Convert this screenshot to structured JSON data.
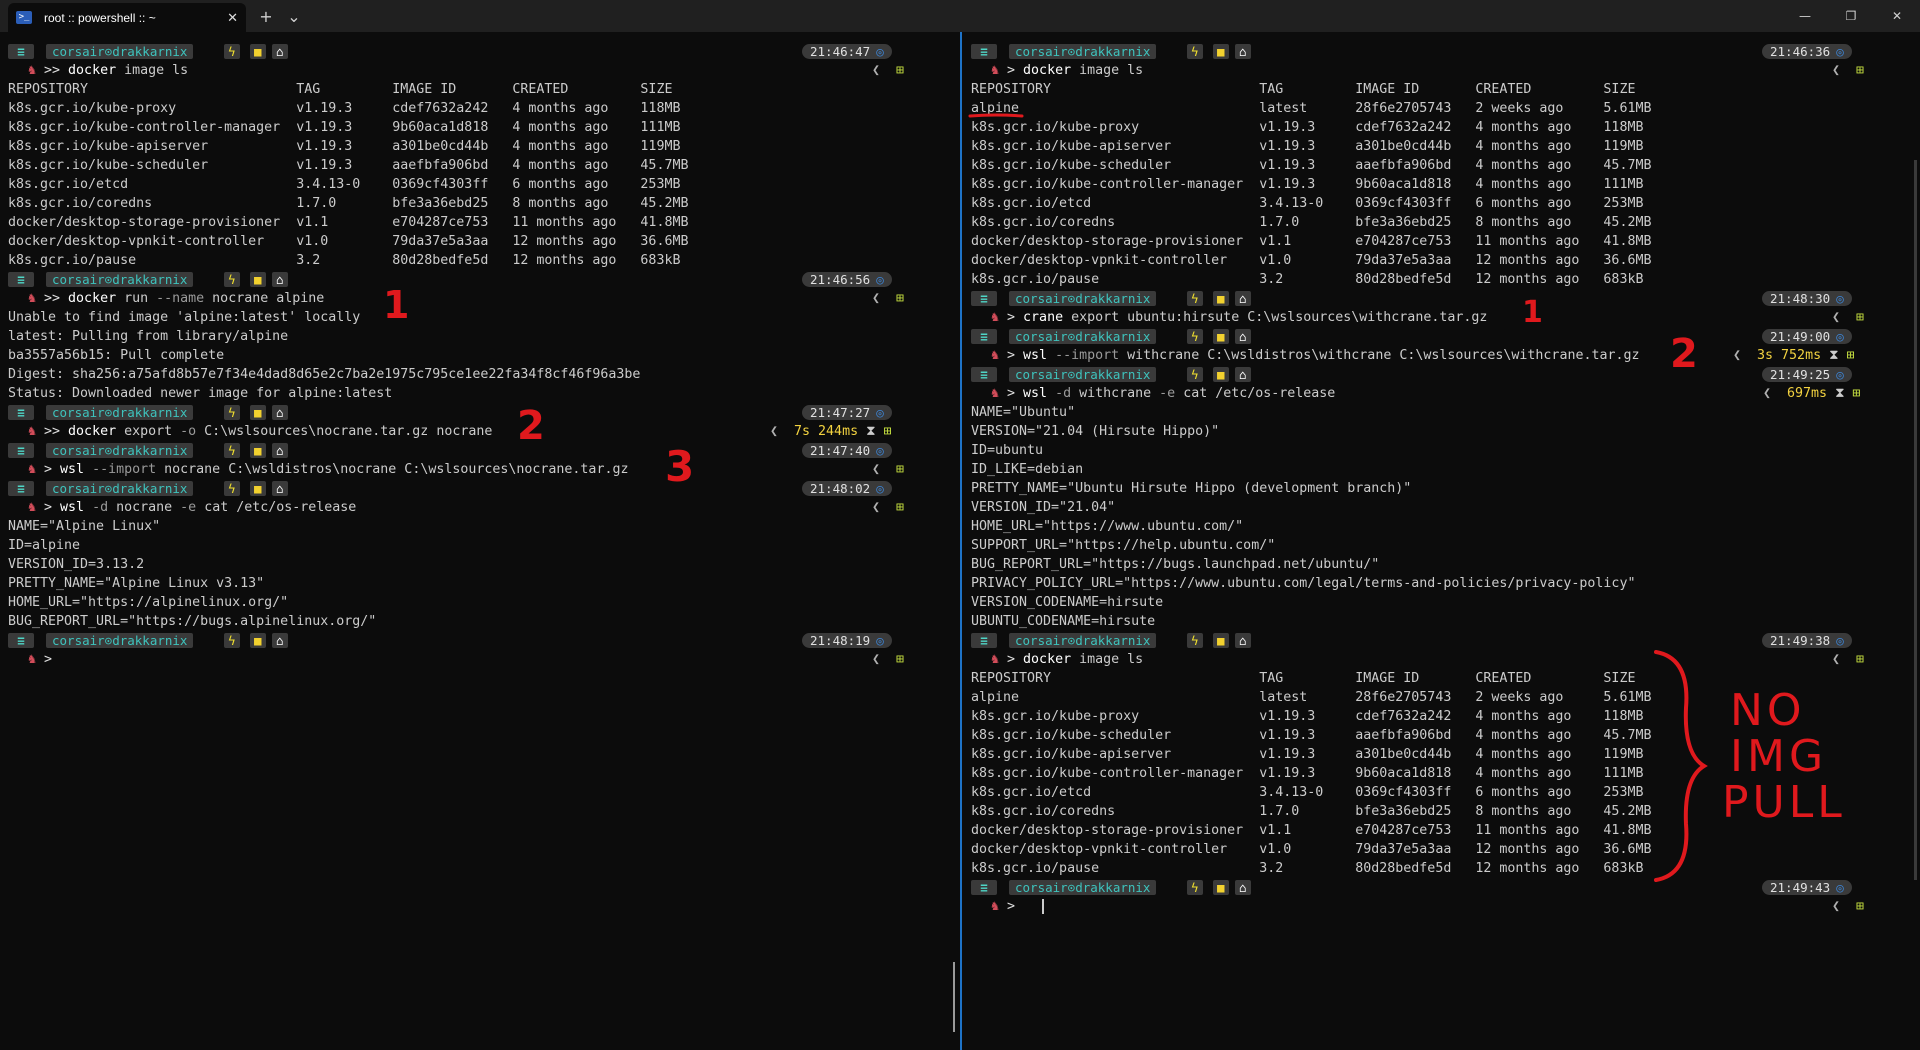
{
  "window": {
    "tab_title": "root :: powershell :: ~",
    "tab_close": "✕",
    "new_tab": "+",
    "dropdown": "⌄",
    "minimize": "—",
    "restore": "❐",
    "close": "✕"
  },
  "prompt": {
    "user": "corsair⊙drakkarnix",
    "menu": "≡",
    "git": "ϟ",
    "folder": "■",
    "home": "⌂",
    "chevron": "❯",
    "right_bracket": "❮",
    "right_icon": "⊞"
  },
  "left": {
    "times": [
      "21:46:47",
      "21:46:56",
      "21:47:27",
      "21:47:40",
      "21:48:02",
      "21:48:19"
    ],
    "commands": [
      {
        "prefix": ">>",
        "cmd": "docker",
        "rest": " image ls"
      },
      {
        "prefix": ">>",
        "cmd": "docker",
        "rest": " run ",
        "flag": "--name",
        "rest2": " nocrane alpine"
      },
      {
        "prefix": ">>",
        "cmd": "docker",
        "rest": " export ",
        "flag": "-o",
        "rest2": " C:\\wslsources\\nocrane.tar.gz nocrane"
      },
      {
        "prefix": ">",
        "cmd": "wsl",
        "rest": " ",
        "flag": "--import",
        "rest2": " nocrane C:\\wsldistros\\nocrane C:\\wslsources\\nocrane.tar.gz"
      },
      {
        "prefix": ">",
        "cmd": "wsl",
        "rest": " ",
        "flag": "-d",
        "rest2": " nocrane ",
        "flag2": "-e",
        "rest3": " cat /etc/os-release"
      },
      {
        "prefix": ">",
        "cmd": "",
        "rest": ""
      }
    ],
    "durations": [
      "7s 244ms"
    ],
    "image_table": [
      "REPOSITORY                          TAG         IMAGE ID       CREATED         SIZE",
      "k8s.gcr.io/kube-proxy               v1.19.3     cdef7632a242   4 months ago    118MB",
      "k8s.gcr.io/kube-controller-manager  v1.19.3     9b60aca1d818   4 months ago    111MB",
      "k8s.gcr.io/kube-apiserver           v1.19.3     a301be0cd44b   4 months ago    119MB",
      "k8s.gcr.io/kube-scheduler           v1.19.3     aaefbfa906bd   4 months ago    45.7MB",
      "k8s.gcr.io/etcd                     3.4.13-0    0369cf4303ff   6 months ago    253MB",
      "k8s.gcr.io/coredns                  1.7.0       bfe3a36ebd25   8 months ago    45.2MB",
      "docker/desktop-storage-provisioner  v1.1        e704287ce753   11 months ago   41.8MB",
      "docker/desktop-vpnkit-controller    v1.0        79da37e5a3aa   12 months ago   36.6MB",
      "k8s.gcr.io/pause                    3.2         80d28bedfe5d   12 months ago   683kB"
    ],
    "run_output": [
      "Unable to find image 'alpine:latest' locally",
      "latest: Pulling from library/alpine",
      "ba3557a56b15: Pull complete",
      "Digest: sha256:a75afd8b57e7f34e4dad8d65e2c7ba2e1975c795ce1ee22fa34f8cf46f96a3be",
      "Status: Downloaded newer image for alpine:latest"
    ],
    "os_release": [
      "NAME=\"Alpine Linux\"",
      "ID=alpine",
      "VERSION_ID=3.13.2",
      "PRETTY_NAME=\"Alpine Linux v3.13\"",
      "HOME_URL=\"https://alpinelinux.org/\"",
      "BUG_REPORT_URL=\"https://bugs.alpinelinux.org/\""
    ]
  },
  "right": {
    "times": [
      "21:46:36",
      "21:48:30",
      "21:49:00",
      "21:49:25",
      "21:49:38",
      "21:49:43"
    ],
    "commands": [
      {
        "prefix": ">",
        "cmd": "docker",
        "rest": " image ls"
      },
      {
        "prefix": ">",
        "cmd": "crane",
        "rest": " export ubuntu:hirsute C:\\wslsources\\withcrane.tar.gz"
      },
      {
        "prefix": ">",
        "cmd": "wsl",
        "rest": " ",
        "flag": "--import",
        "rest2": " withcrane C:\\wsldistros\\withcrane C:\\wslsources\\withcrane.tar.gz"
      },
      {
        "prefix": ">",
        "cmd": "wsl",
        "rest": " ",
        "flag": "-d",
        "rest2": " withcrane ",
        "flag2": "-e",
        "rest3": " cat /etc/os-release"
      },
      {
        "prefix": ">",
        "cmd": "docker",
        "rest": " image ls"
      },
      {
        "prefix": ">",
        "cmd": "",
        "rest": ""
      }
    ],
    "durations": [
      "3s 752ms",
      "697ms"
    ],
    "image_table_1": [
      "REPOSITORY                          TAG         IMAGE ID       CREATED         SIZE",
      "alpine                              latest      28f6e2705743   2 weeks ago     5.61MB",
      "k8s.gcr.io/kube-proxy               v1.19.3     cdef7632a242   4 months ago    118MB",
      "k8s.gcr.io/kube-apiserver           v1.19.3     a301be0cd44b   4 months ago    119MB",
      "k8s.gcr.io/kube-scheduler           v1.19.3     aaefbfa906bd   4 months ago    45.7MB",
      "k8s.gcr.io/kube-controller-manager  v1.19.3     9b60aca1d818   4 months ago    111MB",
      "k8s.gcr.io/etcd                     3.4.13-0    0369cf4303ff   6 months ago    253MB",
      "k8s.gcr.io/coredns                  1.7.0       bfe3a36ebd25   8 months ago    45.2MB",
      "docker/desktop-storage-provisioner  v1.1        e704287ce753   11 months ago   41.8MB",
      "docker/desktop-vpnkit-controller    v1.0        79da37e5a3aa   12 months ago   36.6MB",
      "k8s.gcr.io/pause                    3.2         80d28bedfe5d   12 months ago   683kB"
    ],
    "os_release": [
      "NAME=\"Ubuntu\"",
      "VERSION=\"21.04 (Hirsute Hippo)\"",
      "ID=ubuntu",
      "ID_LIKE=debian",
      "PRETTY_NAME=\"Ubuntu Hirsute Hippo (development branch)\"",
      "VERSION_ID=\"21.04\"",
      "HOME_URL=\"https://www.ubuntu.com/\"",
      "SUPPORT_URL=\"https://help.ubuntu.com/\"",
      "BUG_REPORT_URL=\"https://bugs.launchpad.net/ubuntu/\"",
      "PRIVACY_POLICY_URL=\"https://www.ubuntu.com/legal/terms-and-policies/privacy-policy\"",
      "VERSION_CODENAME=hirsute",
      "UBUNTU_CODENAME=hirsute"
    ],
    "image_table_2": [
      "REPOSITORY                          TAG         IMAGE ID       CREATED         SIZE",
      "alpine                              latest      28f6e2705743   2 weeks ago     5.61MB",
      "k8s.gcr.io/kube-proxy               v1.19.3     cdef7632a242   4 months ago    118MB",
      "k8s.gcr.io/kube-scheduler           v1.19.3     aaefbfa906bd   4 months ago    45.7MB",
      "k8s.gcr.io/kube-apiserver           v1.19.3     a301be0cd44b   4 months ago    119MB",
      "k8s.gcr.io/kube-controller-manager  v1.19.3     9b60aca1d818   4 months ago    111MB",
      "k8s.gcr.io/etcd                     3.4.13-0    0369cf4303ff   6 months ago    253MB",
      "k8s.gcr.io/coredns                  1.7.0       bfe3a36ebd25   8 months ago    45.2MB",
      "docker/desktop-storage-provisioner  v1.1        e704287ce753   11 months ago   41.8MB",
      "docker/desktop-vpnkit-controller    v1.0        79da37e5a3aa   12 months ago   36.6MB",
      "k8s.gcr.io/pause                    3.2         80d28bedfe5d   12 months ago   683kB"
    ]
  },
  "annotations": {
    "left_1": "1",
    "left_2": "2",
    "left_3": "3",
    "right_1": "1",
    "right_2": "2",
    "no_img_pull": [
      "NO",
      "IMG",
      "PULL"
    ]
  }
}
